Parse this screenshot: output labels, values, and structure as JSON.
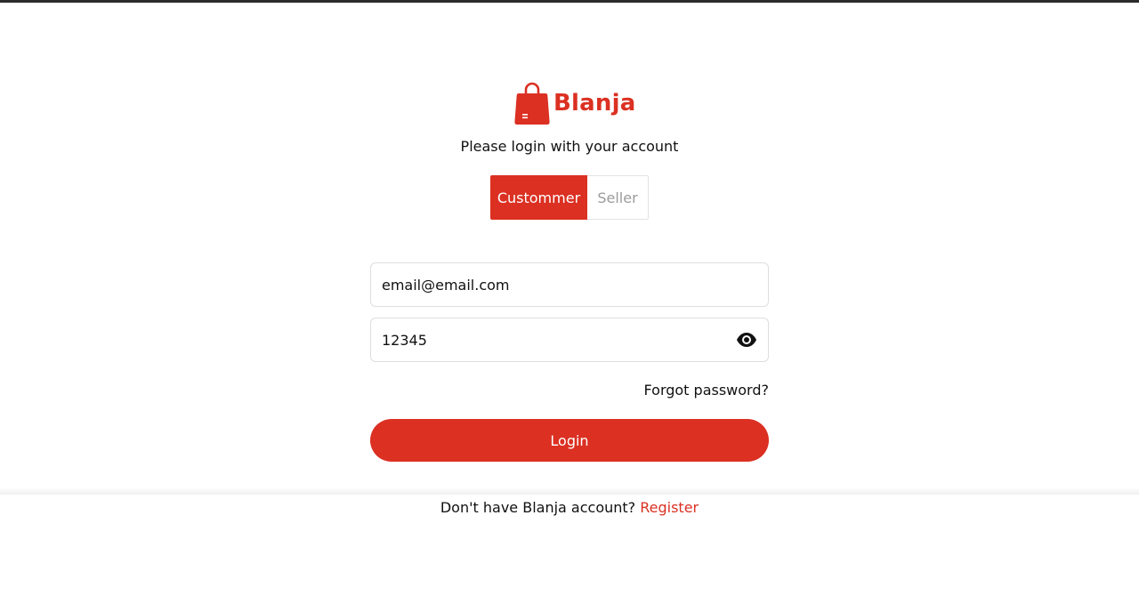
{
  "brand": {
    "name": "Blanja",
    "logo_icon": "shopping-bag-icon",
    "color": "#db3022"
  },
  "subtitle": "Please login with your account",
  "role_toggle": {
    "selected": "Custommer",
    "options": [
      "Custommer",
      "Seller"
    ]
  },
  "form": {
    "email_value": "email@email.com",
    "password_value": "12345",
    "password_toggle_icon": "eye-icon",
    "forgot_label": "Forgot password?",
    "login_label": "Login"
  },
  "footer": {
    "prompt": "Don't have Blanja account?",
    "register_label": "Register"
  },
  "colors": {
    "accent": "#db3022",
    "inactive_text": "#9b9b9b"
  }
}
